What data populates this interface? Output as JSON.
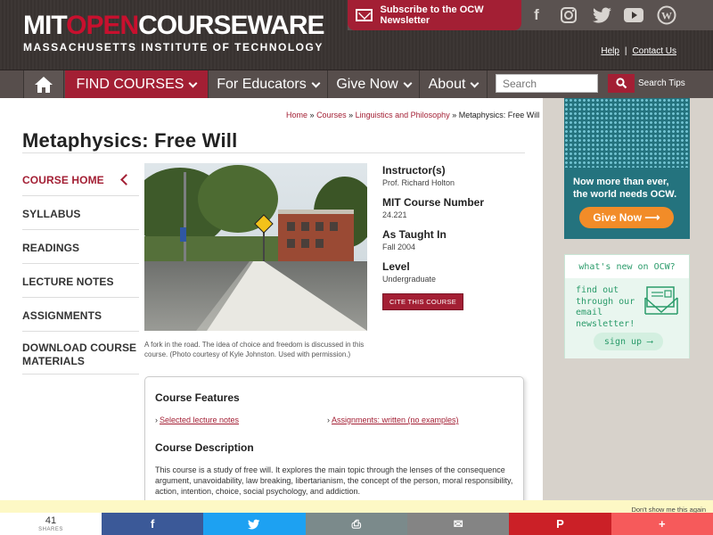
{
  "header": {
    "logo_part1": "MIT",
    "logo_part2": "OPEN",
    "logo_part3": "COURSEWARE",
    "logo_subtitle": "MASSACHUSETTS INSTITUTE OF TECHNOLOGY",
    "newsletter_label": "Subscribe to the OCW Newsletter",
    "social": [
      {
        "name": "facebook",
        "glyph": "f"
      },
      {
        "name": "instagram",
        "glyph": "◎"
      },
      {
        "name": "twitter",
        "glyph": "t"
      },
      {
        "name": "youtube",
        "glyph": "▶"
      },
      {
        "name": "wordpress",
        "glyph": "W"
      }
    ],
    "help": "Help",
    "contact": "Contact Us"
  },
  "nav": {
    "find_courses": "FIND COURSES",
    "for_educators": "For Educators",
    "give_now": "Give Now",
    "about": "About",
    "search_placeholder": "Search",
    "search_tips": "Search Tips"
  },
  "breadcrumb": {
    "home": "Home",
    "courses": "Courses",
    "dept": "Linguistics and Philosophy",
    "current": "Metaphysics: Free Will",
    "sep": "»"
  },
  "page_title": "Metaphysics: Free Will",
  "sidebar": {
    "items": [
      {
        "label": "COURSE HOME",
        "active": true
      },
      {
        "label": "SYLLABUS"
      },
      {
        "label": "READINGS"
      },
      {
        "label": "LECTURE NOTES"
      },
      {
        "label": "ASSIGNMENTS"
      },
      {
        "label": "DOWNLOAD COURSE MATERIALS"
      }
    ]
  },
  "photo_caption": "A fork in the road. The idea of choice and freedom is discussed in this course. (Photo courtesy of Kyle Johnston. Used with permission.)",
  "info": {
    "instructor_label": "Instructor(s)",
    "instructor": "Prof. Richard Holton",
    "number_label": "MIT Course Number",
    "number": "24.221",
    "taught_label": "As Taught In",
    "taught": "Fall 2004",
    "level_label": "Level",
    "level": "Undergraduate",
    "cite": "CITE THIS COURSE"
  },
  "features": {
    "title": "Course Features",
    "link1": "Selected lecture notes",
    "link2": "Assignments: written (no examples)",
    "desc_title": "Course Description",
    "desc": "This course is a study of free will. It explores the main topic through the lenses of the consequence argument, unavoidability, law breaking, libertarianism, the concept of the person, moral responsibility, action, intention, choice, social psychology, and addiction."
  },
  "ads": {
    "give_msg": "Now more than ever, the world needs OCW.",
    "give_btn": "Give Now ⟶",
    "news_head": "what's new on OCW?",
    "news_body": "find out through our email newsletter!",
    "news_btn": "sign up ⟶"
  },
  "notice": {
    "dont_show": "Don't show me this again"
  },
  "share": {
    "count": "41",
    "label": "SHARES",
    "buttons": [
      {
        "name": "facebook",
        "glyph": "f",
        "color": "#3b5998"
      },
      {
        "name": "twitter",
        "glyph": "t",
        "color": "#1da1f2"
      },
      {
        "name": "print",
        "glyph": "⎙",
        "color": "#7b8a8b"
      },
      {
        "name": "email",
        "glyph": "✉",
        "color": "#848484"
      },
      {
        "name": "pinterest",
        "glyph": "P",
        "color": "#cb2027"
      },
      {
        "name": "more",
        "glyph": "+",
        "color": "#f65a5b"
      }
    ]
  },
  "colors": {
    "brand_red": "#a31f34",
    "header_bg": "#3b3533",
    "ocw_teal": "#24737e",
    "give_orange": "#f28c28"
  }
}
